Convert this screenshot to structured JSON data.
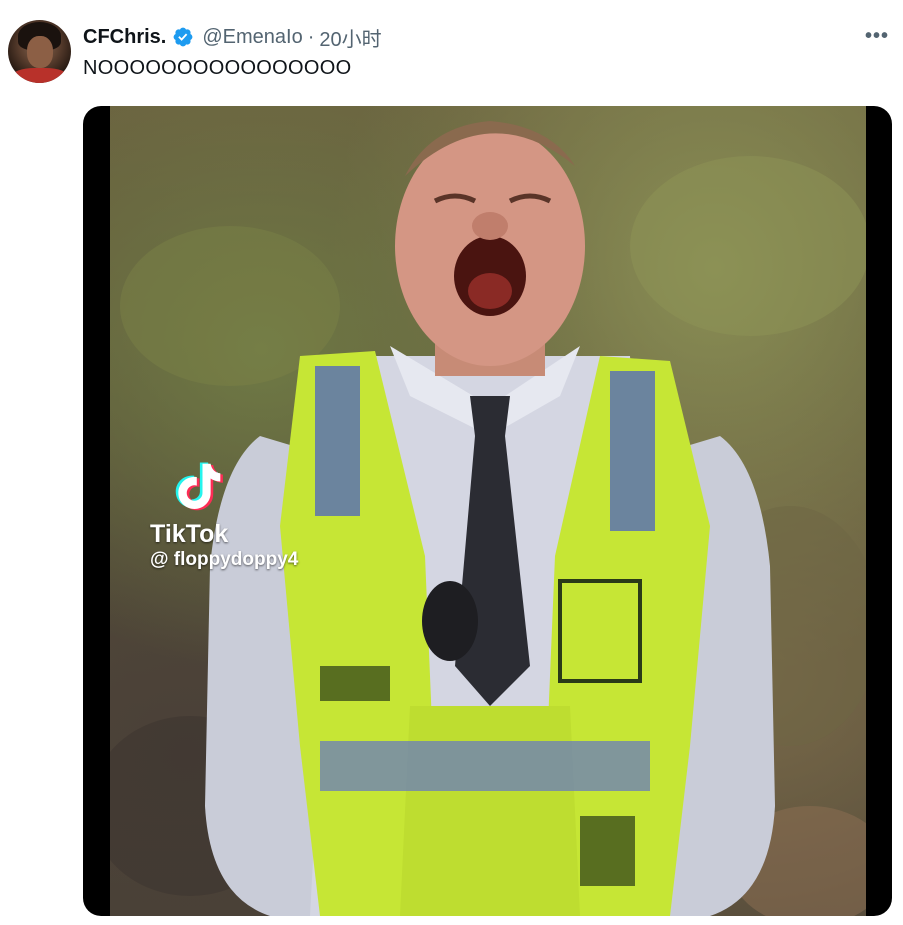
{
  "tweet": {
    "display_name": "CFChris.",
    "handle": "@EmenaIo",
    "separator": "·",
    "time": "20小时",
    "text": "NOOOOOOOOOOOOOOOO",
    "more_label": "•••"
  },
  "media": {
    "watermark": {
      "brand": "TikTok",
      "username": "@ floppydoppy4"
    }
  },
  "colors": {
    "verified": "#1d9bf0",
    "text_primary": "#0f1419",
    "text_secondary": "#536471"
  },
  "icons": [
    "avatar",
    "verified-badge-icon",
    "more-options-icon",
    "tiktok-logo-icon"
  ]
}
